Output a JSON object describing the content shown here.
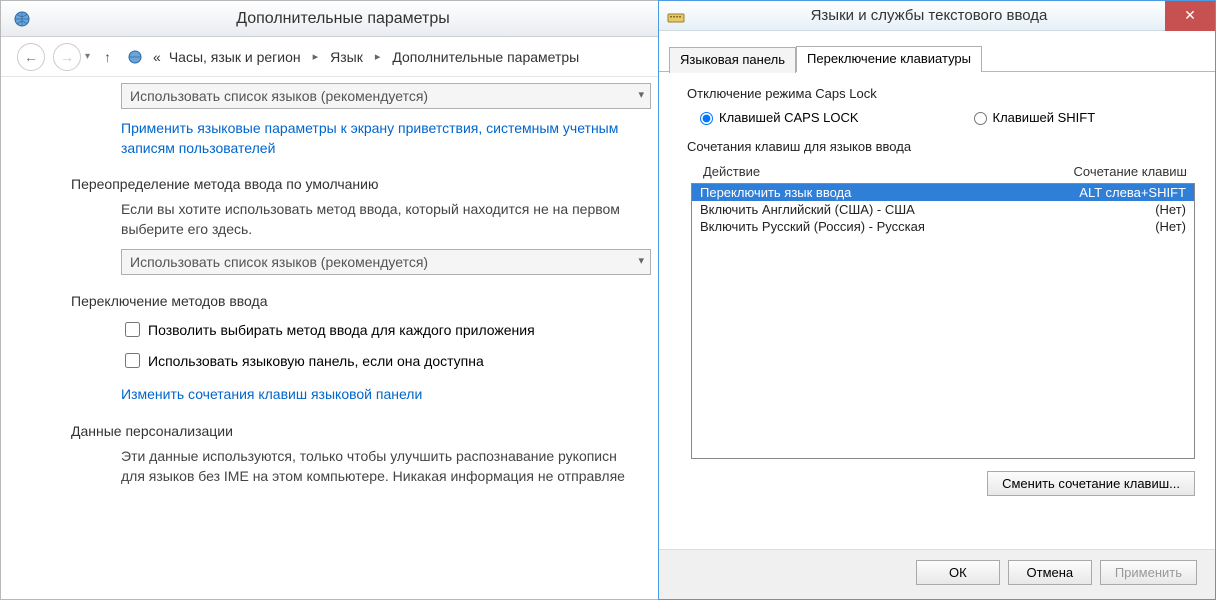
{
  "left": {
    "title": "Дополнительные параметры",
    "breadcrumb": {
      "ellipsis": "«",
      "seg1": "Часы, язык и регион",
      "seg2": "Язык",
      "seg3": "Дополнительные параметры"
    },
    "dropdown_label": "Использовать список языков (рекомендуется)",
    "link_welcome": "Применить языковые параметры к экрану приветствия, системным учетным записям пользователей",
    "section_override": "Переопределение метода ввода по умолчанию",
    "override_text": "Если вы хотите использовать метод ввода, который находится не на первом выберите его здесь.",
    "section_switch": "Переключение методов ввода",
    "check1": "Позволить выбирать метод ввода для каждого приложения",
    "check2": "Использовать языковую панель, если она доступна",
    "link_hotkeys": "Изменить сочетания клавиш языковой панели",
    "section_personal": "Данные персонализации",
    "personal_text": "Эти данные используются, только чтобы улучшить распознавание рукописн для языков без IME на этом компьютере. Никакая информация не отправляе"
  },
  "right": {
    "title": "Языки и службы текстового ввода",
    "tab1": "Языковая панель",
    "tab2": "Переключение клавиатуры",
    "caps_group": "Отключение режима Caps Lock",
    "radio_caps": "Клавишей CAPS LOCK",
    "radio_shift": "Клавишей SHIFT",
    "hotkeys_group": "Сочетания клавиш для языков ввода",
    "col_action": "Действие",
    "col_hotkey": "Сочетание клавиш",
    "rows": [
      {
        "action": "Переключить язык ввода",
        "hotkey": "ALT слева+SHIFT"
      },
      {
        "action": "Включить Английский (США) - США",
        "hotkey": "(Нет)"
      },
      {
        "action": "Включить Русский (Россия) - Русская",
        "hotkey": "(Нет)"
      }
    ],
    "change_btn": "Сменить сочетание клавиш...",
    "ok": "ОК",
    "cancel": "Отмена",
    "apply": "Применить"
  }
}
